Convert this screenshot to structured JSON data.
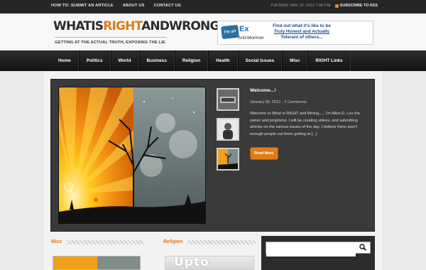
{
  "topbar": {
    "links": [
      "HOW TO: SUBMIT AN ARTICLE",
      "ABOUT US",
      "CONTACT US"
    ],
    "date": "TUESDAY, MAY, 22, 2012 7:06 P.M.",
    "rss_label": "SUBSCRIBE TO RSS"
  },
  "header": {
    "logo_part1": "WHATIS",
    "logo_part2": "RIGHT",
    "logo_part3": "ANDWRONG",
    "tagline": "GETTING AT THE ACTUAL TRUTH, EXPOSING THE LIE",
    "banner": {
      "badge": "I'm an",
      "ex": "Ex",
      "anti": "Anti-Mormon",
      "text_line1": "Find out what it's like to be",
      "text_line2": "Truly Honest and Actually",
      "text_line3": "Tolerant of others..."
    }
  },
  "nav": {
    "items": [
      "Home",
      "Politics",
      "World",
      "Business",
      "Religion",
      "Health",
      "Social Issues",
      "Misc",
      "RIGHT Links"
    ]
  },
  "slider": {
    "title": "Welcome...!",
    "meta": "January 05, 2012 - 2 Comments",
    "excerpt": "Welcome to What is RIGHT and Wrong..... I'm Allen D. Lee the owner and proprietor. I will be creating videos, and submitting articles on the various issues of the day. I believe there aren't enough people out there getting at [...]",
    "read_more": "Read More"
  },
  "sections": {
    "misc": "Misc",
    "religion": "Religion",
    "religion_img_text": "Upto"
  },
  "sidebar": {
    "search_placeholder": ""
  },
  "colors": {
    "accent": "#e07b1e",
    "topbar": "#262626",
    "nav": "#1c1c1c",
    "slider_bg": "#3a3a3a"
  }
}
